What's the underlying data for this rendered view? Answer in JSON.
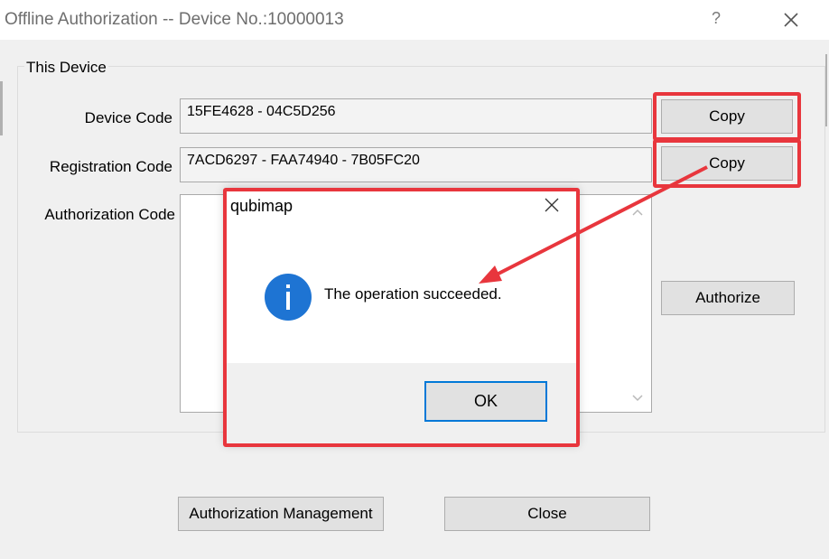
{
  "window": {
    "title": "Offline Authorization -- Device No.:10000013",
    "help_glyph": "?"
  },
  "group": {
    "label": "This Device"
  },
  "device_code": {
    "label": "Device Code",
    "value": "15FE4628 - 04C5D256",
    "copy_label": "Copy"
  },
  "registration_code": {
    "label": "Registration Code",
    "value": "7ACD6297 - FAA74940 - 7B05FC20",
    "copy_label": "Copy"
  },
  "authorization_code": {
    "label": "Authorization Code",
    "value": ""
  },
  "buttons": {
    "authorize": "Authorize",
    "authorization_management": "Authorization Management",
    "close": "Close"
  },
  "message_box": {
    "title": "qubimap",
    "icon": "info-icon",
    "message": "The operation succeeded.",
    "ok_label": "OK"
  },
  "colors": {
    "highlight_red": "#e8363d",
    "info_blue": "#1e74d3",
    "focus_blue": "#0078d7"
  }
}
